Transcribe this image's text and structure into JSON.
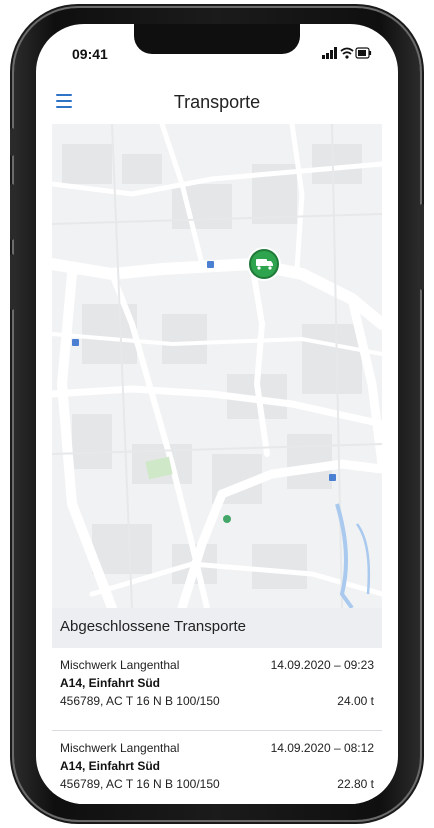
{
  "status_bar": {
    "time": "09:41",
    "icons": [
      "signal-icon",
      "wifi-icon",
      "battery-icon"
    ]
  },
  "header": {
    "menu_icon": "hamburger-menu-icon",
    "title": "Transporte"
  },
  "map": {
    "marker_icon": "truck-marker-icon",
    "marker_color": "#2ea44f"
  },
  "completed": {
    "title": "Abgeschlossene Transporte",
    "items": [
      {
        "origin": "Mischwerk Langenthal",
        "datetime": "14.09.2020 – 09:23",
        "destination": "A14, Einfahrt Süd",
        "details": "456789, AC T 16 N B 100/150",
        "weight": "24.00 t"
      },
      {
        "origin": "Mischwerk Langenthal",
        "datetime": "14.09.2020 – 08:12",
        "destination": "A14, Einfahrt Süd",
        "details": "456789, AC T 16 N B 100/150",
        "weight": "22.80 t"
      }
    ]
  },
  "colors": {
    "accent": "#2d74c9",
    "marker": "#2ea44f",
    "section_bg": "#eceef1"
  }
}
